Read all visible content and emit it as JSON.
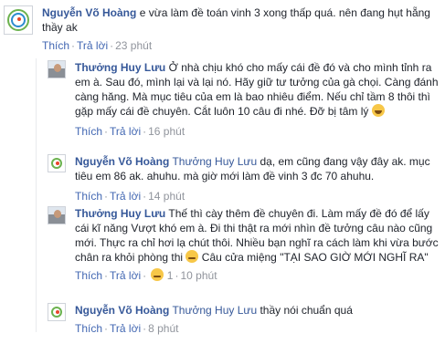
{
  "comments": [
    {
      "author": "Nguyễn Võ Hoàng",
      "mention": "",
      "text": "e vừa làm đề toán vinh 3 xong thấp quá. nên đang hụt hẵng thầy ak",
      "like": "Thích",
      "reply": "Trả lời",
      "time": "23 phút"
    },
    {
      "author": "Thưởng Huy Lưu",
      "mention": "",
      "text": "Ở nhà chịu khó cho mấy cái đề đó và cho mình tỉnh ra em à. Sau đó, mình lại và lại nó. Hãy giữ tư tưởng của gà chọi. Càng đánh càng hăng. Mà mục tiêu của em là bao nhiêu điểm. Nếu chỉ tầm 8 thôi thì gặp mấy cái đề chuyên. Cắt luôn 10 câu đi nhé. Đỡ bị tâm lý",
      "emoji": "smile-emoji",
      "like": "Thích",
      "reply": "Trả lời",
      "time": "16 phút"
    },
    {
      "author": "Nguyễn Võ Hoàng",
      "mention": "Thưởng Huy Lưu",
      "text": "dạ, em cũng đang vậy đây ak. mục tiêu em 86 ak. ahuhu. mà giờ mới làm đề vinh 3 đc 70 ahuhu.",
      "like": "Thích",
      "reply": "Trả lời",
      "time": "14 phút"
    },
    {
      "author": "Thưởng Huy Lưu",
      "mention": "",
      "text": "Thế thì cày thêm đề chuyên đi. Làm mấy đề đó để lấy cái kĩ năng Vượt khó em à. Đi thi thật ra mới nhìn đề tưởng câu nào cũng mới. Thực ra chỉ hơi lạ chút thôi. Nhiều bạn nghĩ ra cách làm khi vừa bước chân ra khỏi phòng thi",
      "text2": "Câu cửa miệng \"TẠI SAO GIỜ MỚI NGHĨ RA\"",
      "emoji": "sad-emoji",
      "like": "Thích",
      "reply": "Trả lời",
      "reaction_count": "1",
      "time": "10 phút"
    },
    {
      "author": "Nguyễn Võ Hoàng",
      "mention": "Thưởng Huy Lưu",
      "text": "thầy nói chuẩn quá",
      "like": "Thích",
      "reply": "Trả lời",
      "time": "8 phút"
    }
  ],
  "colors": {
    "name": "#365899",
    "link": "#4267b2",
    "meta": "#90949c"
  }
}
